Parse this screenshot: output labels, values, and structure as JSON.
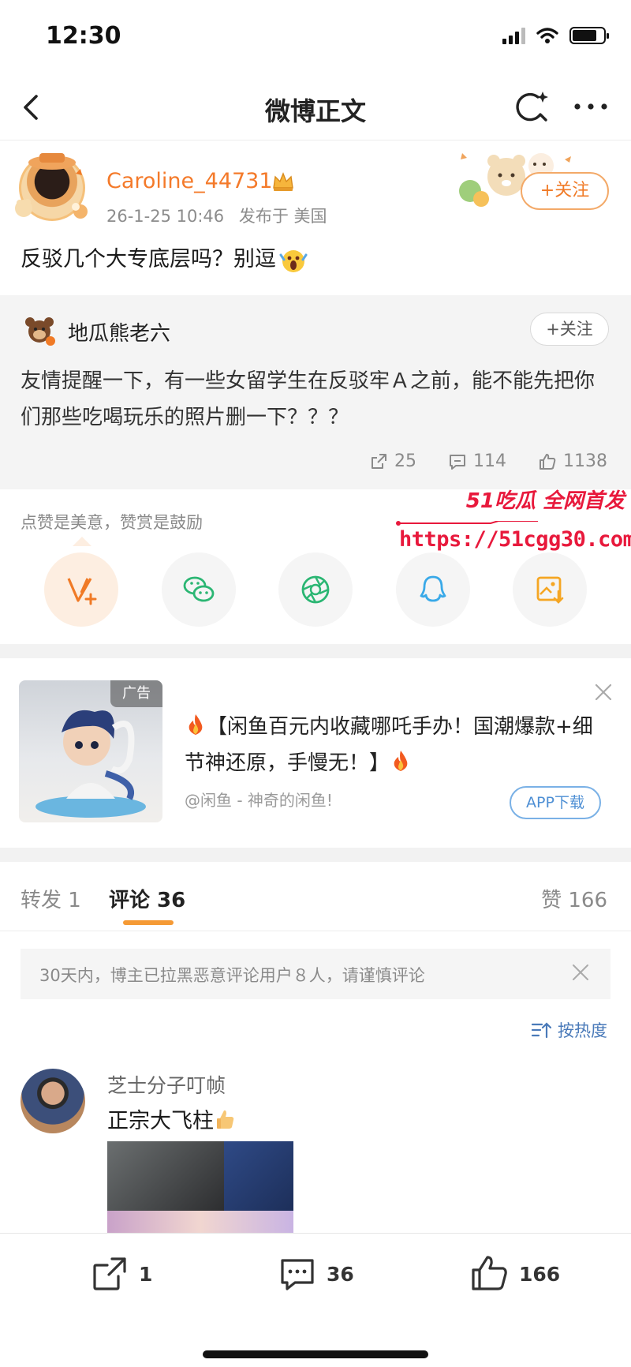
{
  "status_bar": {
    "time": "12:30",
    "battery_level": 0.8
  },
  "nav": {
    "title": "微博正文"
  },
  "post": {
    "author": "Caroline_44731",
    "date": "26-1-25 10:46",
    "location": "发布于 美国",
    "follow_label": "+关注",
    "text": "反驳几个大专底层吗？别逗"
  },
  "repost": {
    "author": "地瓜熊老六",
    "follow_label": "+关注",
    "text": "友情提醒一下，有一些女留学生在反驳牢Ａ之前，能不能先把你们那些吃喝玩乐的照片删一下？？？",
    "reposts": "25",
    "comments": "114",
    "likes": "1138"
  },
  "reward": {
    "hint": "点赞是美意，赞赏是鼓励"
  },
  "watermark": {
    "brand": "51吃瓜 全网首发",
    "url": "https://51cgg30.com"
  },
  "share": [
    {
      "name": "reward",
      "icon": "reward-v-icon",
      "color": "#f07a26"
    },
    {
      "name": "wechat",
      "icon": "wechat-icon",
      "color": "#2bb673"
    },
    {
      "name": "moments",
      "icon": "moments-icon",
      "color": "#2bb673"
    },
    {
      "name": "qq",
      "icon": "qq-icon",
      "color": "#39a9e8"
    },
    {
      "name": "save-image",
      "icon": "save-image-icon",
      "color": "#f5a623"
    }
  ],
  "ad": {
    "tag": "广告",
    "title": "【闲鱼百元内收藏哪吒手办！国潮爆款+细节神还原，手慢无！】",
    "source": "@闲鱼 - 神奇的闲鱼!",
    "cta": "APP下载"
  },
  "tabs": {
    "repost_label": "转发 1",
    "comment_label": "评论 36",
    "like_label": "赞 166"
  },
  "notice": {
    "text": "30天内，博主已拉黑恶意评论用户８人，请谨慎评论"
  },
  "sort": {
    "label": "按热度"
  },
  "comment": {
    "user": "芝士分子叮帧",
    "text": "正宗大飞柱"
  },
  "bottom_bar": {
    "reposts": "1",
    "comments": "36",
    "likes": "166"
  },
  "colors": {
    "accent": "#f07a26",
    "link": "#4a7ab9",
    "watermark": "#e8193c"
  }
}
